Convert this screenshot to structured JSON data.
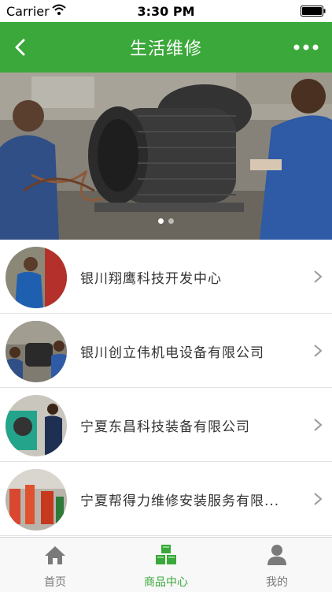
{
  "status_bar": {
    "carrier": "Carrier",
    "time": "3:30 PM",
    "wifi_icon": "wifi-icon",
    "battery_icon": "battery-icon"
  },
  "nav": {
    "title": "生活维修",
    "back_icon": "chevron-left-icon",
    "more_icon": "more-dots-icon"
  },
  "banner": {
    "slide_count": 2,
    "active_slide": 0
  },
  "list": {
    "items": [
      {
        "name": "银川翔鹰科技开发中心"
      },
      {
        "name": "银川创立伟机电设备有限公司"
      },
      {
        "name": "宁夏东昌科技装备有限公司"
      },
      {
        "name": "宁夏帮得力维修安装服务有限..."
      }
    ]
  },
  "tabs": [
    {
      "label": "首页",
      "icon": "home-icon",
      "active": false
    },
    {
      "label": "商品中心",
      "icon": "cubes-icon",
      "active": true
    },
    {
      "label": "我的",
      "icon": "user-icon",
      "active": false
    }
  ],
  "colors": {
    "accent": "#3aa83a",
    "tab_inactive": "#7a7a7a",
    "text": "#333333"
  }
}
